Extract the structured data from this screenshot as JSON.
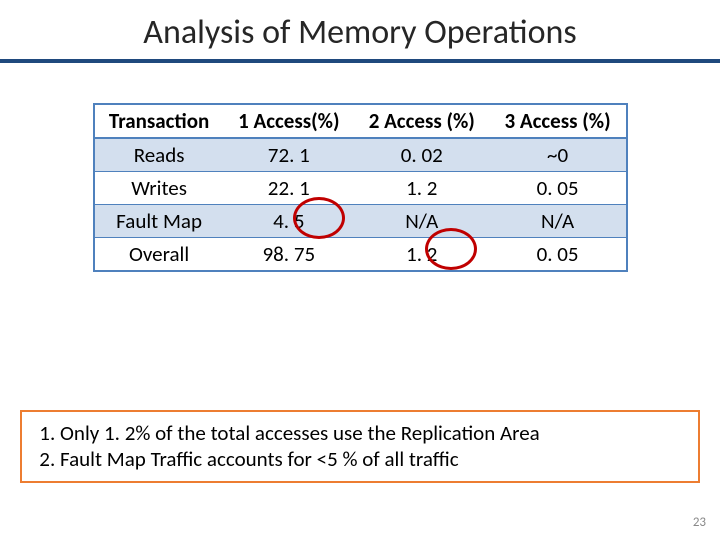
{
  "title": "Analysis of Memory Operations",
  "table": {
    "headers": [
      "Transaction",
      "1 Access(%)",
      "2 Access (%)",
      "3 Access (%)"
    ],
    "rows": [
      [
        "Reads",
        "72. 1",
        "0. 02",
        "~0"
      ],
      [
        "Writes",
        "22. 1",
        "1. 2",
        "0. 05"
      ],
      [
        "Fault Map",
        "4. 5",
        "N/A",
        "N/A"
      ],
      [
        "Overall",
        "98. 75",
        "1. 2",
        "0. 05"
      ]
    ]
  },
  "notes": [
    "Only 1. 2% of the total accesses use the Replication Area",
    "Fault Map Traffic accounts for <5 % of all traffic"
  ],
  "page_number": "23"
}
